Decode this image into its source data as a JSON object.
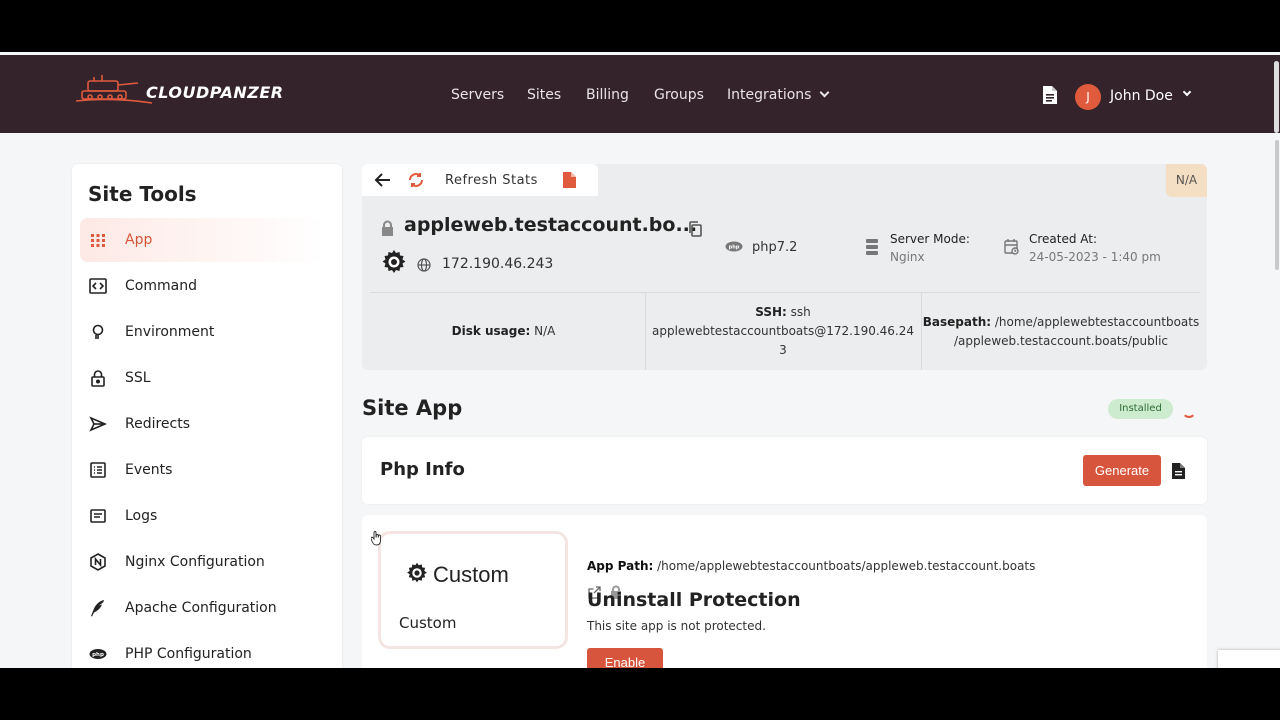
{
  "header": {
    "brand": "CLOUDPANZER",
    "nav": [
      "Servers",
      "Sites",
      "Billing",
      "Groups",
      "Integrations"
    ],
    "avatar_initial": "J",
    "user_name": "John Doe"
  },
  "sidebar": {
    "title": "Site Tools",
    "items": [
      {
        "label": "App",
        "icon": "grid-icon",
        "active": true
      },
      {
        "label": "Command",
        "icon": "code-icon"
      },
      {
        "label": "Environment",
        "icon": "bulb-icon"
      },
      {
        "label": "SSL",
        "icon": "lock-icon"
      },
      {
        "label": "Redirects",
        "icon": "send-icon"
      },
      {
        "label": "Events",
        "icon": "list-icon"
      },
      {
        "label": "Logs",
        "icon": "log-icon"
      },
      {
        "label": "Nginx Configuration",
        "icon": "nginx-icon"
      },
      {
        "label": "Apache Configuration",
        "icon": "feather-icon"
      },
      {
        "label": "PHP Configuration",
        "icon": "php-icon"
      }
    ]
  },
  "toolbar": {
    "refresh_label": "Refresh Stats",
    "badge": "N/A"
  },
  "site": {
    "name": "appleweb.testaccount.bo...",
    "ip": "172.190.46.243",
    "php": "php7.2",
    "server_mode_label": "Server Mode:",
    "server_mode": "Nginx",
    "created_label": "Created At:",
    "created": "24-05-2023 - 1:40 pm",
    "disk_label": "Disk usage:",
    "disk": "N/A",
    "ssh_label": "SSH:",
    "ssh_line1": "ssh",
    "ssh_line2": "applewebtestaccountboats@172.190.46.24",
    "ssh_line3": "3",
    "basepath_label": "Basepath:",
    "basepath_line1": "/home/applewebtestaccountboats",
    "basepath_line2": "/appleweb.testaccount.boats/public"
  },
  "site_app": {
    "title": "Site App",
    "status": "Installed",
    "phpinfo_title": "Php Info",
    "generate_label": "Generate",
    "app_logo_text": "Custom",
    "app_name": "Custom",
    "app_path_label": "App Path:",
    "app_path": "/home/applewebtestaccountboats/appleweb.testaccount.boats",
    "protection_title": "Uninstall Protection",
    "protection_text": "This site app is not protected.",
    "enable_label": "Enable"
  },
  "colors": {
    "header_bg": "#34232a",
    "accent": "#d8553d"
  }
}
